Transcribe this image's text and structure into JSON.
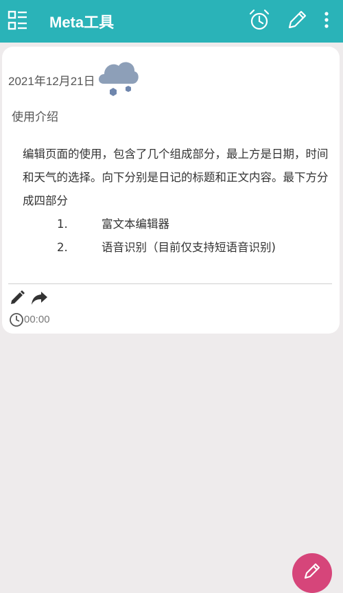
{
  "appbar": {
    "title": "Meta工具",
    "icons": {
      "menu": "list-menu-icon",
      "alarm": "alarm-clock-icon",
      "edit": "pencil-icon",
      "more": "more-vert-icon"
    }
  },
  "diary": {
    "date": "2021年12月21日",
    "weather": "snow-cloud-icon",
    "title": "使用介绍",
    "paragraph": "编辑页面的使用，包含了几个组成部分，最上方是日期，时间和天气的选择。向下分别是日记的标题和正文内容。最下方分成四部分",
    "list": [
      {
        "num": "1.",
        "text": "富文本编辑器"
      },
      {
        "num": "2.",
        "text": "语音识别（目前仅支持短语音识别)"
      }
    ],
    "duration": "00:00"
  },
  "colors": {
    "appbar": "#2ab3b8",
    "fab": "#d6457a",
    "background": "#eeebec",
    "weather_icon": "#8d9fb8"
  }
}
